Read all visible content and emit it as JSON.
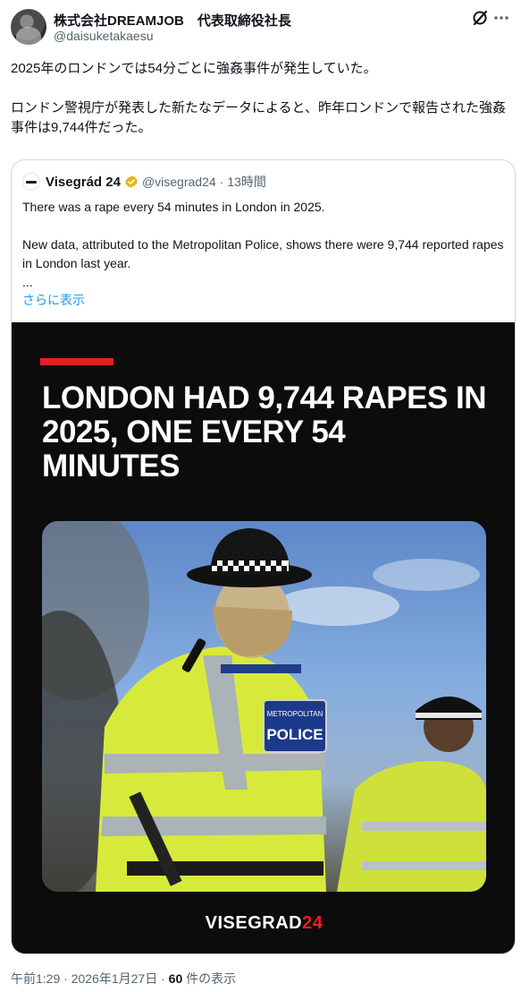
{
  "author": {
    "display_name": "株式会社DREAMJOB　代表取締役社長",
    "handle": "@daisuketakaesu"
  },
  "tweet": {
    "line1": "2025年のロンドンでは54分ごとに強姦事件が発生していた。",
    "line2": "ロンドン警視庁が発表した新たなデータによると、昨年ロンドンで報告された強姦事件は9,744件だった。"
  },
  "quote": {
    "display_name": "Visegrád 24",
    "handle": "@visegrad24",
    "separator": "·",
    "time": "13時間",
    "text1": "There was a rape every 54 minutes in London in 2025.",
    "text2": "New data, attributed to the Metropolitan Police, shows there were 9,744 reported rapes in London last year.",
    "ellipsis": "...",
    "show_more": "さらに表示",
    "media": {
      "headline": "LONDON HAD 9,744 RAPES IN 2025, ONE EVERY 54 MINUTES",
      "vest_text_top": "METROPOLITAN",
      "vest_text_main": "POLICE",
      "brand_main": "VISEGRAD",
      "brand_accent": "24"
    }
  },
  "meta": {
    "time": "午前1:29",
    "separator": "·",
    "date": "2026年1月27日",
    "separator2": "·",
    "views_count": "60",
    "views_label": "件の表示"
  },
  "colors": {
    "text": "#0f1419",
    "muted": "#536471",
    "link": "#1d9bf0",
    "verified": "#e2b719",
    "brand_red": "#e62020",
    "border": "#cfd9de"
  },
  "icons": [
    "avatar",
    "grok-icon",
    "more-icon",
    "verified-badge-icon"
  ]
}
